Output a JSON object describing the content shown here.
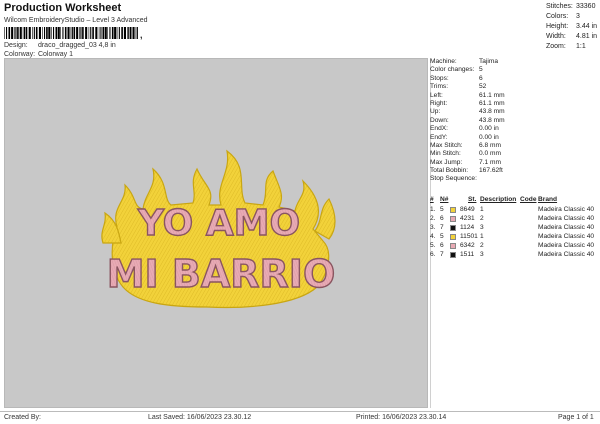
{
  "header": {
    "title": "Production Worksheet",
    "subtitle": "Wilcom EmbroideryStudio – Level 3 Advanced",
    "design_label": "Design:",
    "design_value": "draco_dragged_03 4,8 in",
    "colorway_label": "Colorway:",
    "colorway_value": "Colorway 1"
  },
  "stats_top": [
    {
      "label": "Stitches:",
      "value": "33360"
    },
    {
      "label": "Colors:",
      "value": "3"
    },
    {
      "label": "Height:",
      "value": "3.44 in"
    },
    {
      "label": "Width:",
      "value": "4.81 in"
    },
    {
      "label": "Zoom:",
      "value": "1:1"
    }
  ],
  "machine_info": [
    {
      "label": "Machine:",
      "value": "Tajima"
    },
    {
      "label": "Color changes:",
      "value": "5"
    },
    {
      "label": "Stops:",
      "value": "6"
    },
    {
      "label": "Trims:",
      "value": "52"
    },
    {
      "label": "Left:",
      "value": "61.1 mm"
    },
    {
      "label": "Right:",
      "value": "61.1 mm"
    },
    {
      "label": "Up:",
      "value": "43.8 mm"
    },
    {
      "label": "Down:",
      "value": "43.8 mm"
    },
    {
      "label": "EndX:",
      "value": "0.00 in"
    },
    {
      "label": "EndY:",
      "value": "0.00 in"
    },
    {
      "label": "Max Stitch:",
      "value": "6.8 mm"
    },
    {
      "label": "Min Stitch:",
      "value": "0.0 mm"
    },
    {
      "label": "Max Jump:",
      "value": "7.1 mm"
    },
    {
      "label": "Total Bobbin:",
      "value": "167.62ft"
    },
    {
      "label": "Stop Sequence:",
      "value": ""
    }
  ],
  "sequence": {
    "headers": {
      "num": "#",
      "n": "N#",
      "st": "St.",
      "description": "Description",
      "code": "Code",
      "brand": "Brand"
    },
    "rows": [
      {
        "num": "1.",
        "n": "5",
        "color": "#f2d23a",
        "st": "8649",
        "description": "1",
        "code": "",
        "brand": "Madeira Classic 40"
      },
      {
        "num": "2.",
        "n": "6",
        "color": "#e8aab4",
        "st": "4231",
        "description": "2",
        "code": "",
        "brand": "Madeira Classic 40"
      },
      {
        "num": "3.",
        "n": "7",
        "color": "#111111",
        "st": "1124",
        "description": "3",
        "code": "",
        "brand": "Madeira Classic 40"
      },
      {
        "num": "4.",
        "n": "5",
        "color": "#f2d23a",
        "st": "11501",
        "description": "1",
        "code": "",
        "brand": "Madeira Classic 40"
      },
      {
        "num": "5.",
        "n": "6",
        "color": "#e8aab4",
        "st": "6342",
        "description": "2",
        "code": "",
        "brand": "Madeira Classic 40"
      },
      {
        "num": "6.",
        "n": "7",
        "color": "#111111",
        "st": "1511",
        "description": "3",
        "code": "",
        "brand": "Madeira Classic 40"
      }
    ]
  },
  "design_art": {
    "line1": "YO AMO",
    "line2": "MI BARRIO",
    "flame_color": "#f2d23a",
    "flame_outline": "#c9a612",
    "letter_color": "#e8aab4",
    "letter_outline": "#b27680"
  },
  "footer": {
    "created_by": "Created By:",
    "last_saved": "Last Saved: 16/06/2023 23.30.12",
    "printed": "Printed: 16/06/2023 23.30.14",
    "page": "Page 1 of 1"
  },
  "colors": {
    "canvas_bg": "#c8c8c8"
  }
}
